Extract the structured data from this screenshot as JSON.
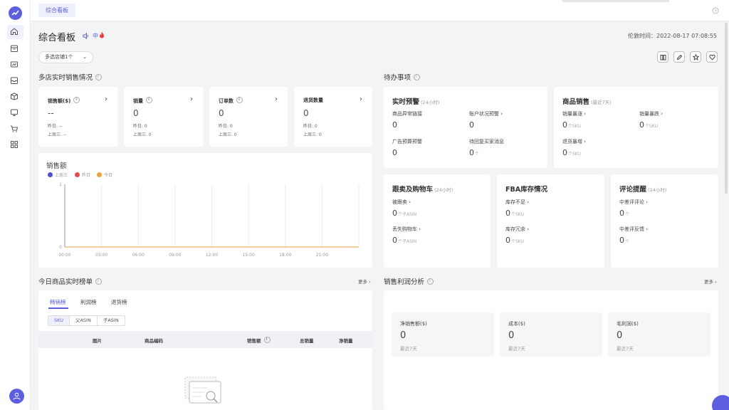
{
  "colors": {
    "accent": "#5b5fe0",
    "last_week": "#4a4fd4",
    "yesterday": "#e05050",
    "today": "#f0a040"
  },
  "topbar": {
    "tab_label": "综合看板"
  },
  "header": {
    "title": "综合看板",
    "voice_label": "中",
    "time_label": "伦敦时间：2022-08-17 07:08:55",
    "store_select": "多选店铺1个"
  },
  "sales_section": {
    "title": "多店实时销售情况",
    "kpis": [
      {
        "title": "销售额($)",
        "value": "--",
        "yesterday": "昨日: --",
        "last_week": "上周三: --"
      },
      {
        "title": "销量",
        "value": "0",
        "yesterday": "昨日: 0",
        "last_week": "上周三: 0"
      },
      {
        "title": "订单数",
        "value": "0",
        "yesterday": "昨日: 0",
        "last_week": "上周三: 0"
      },
      {
        "title": "退货数量",
        "value": "0",
        "yesterday": "昨日: 0",
        "last_week": "上周三: 0"
      }
    ]
  },
  "chart_data": {
    "type": "line",
    "title": "销售额",
    "x": [
      "00:00",
      "03:00",
      "06:00",
      "09:00",
      "12:00",
      "15:00",
      "18:00",
      "21:00"
    ],
    "series": [
      {
        "name": "上周三",
        "values": [
          0,
          0,
          0,
          0,
          0,
          0,
          0,
          0
        ]
      },
      {
        "name": "昨日",
        "values": [
          0,
          0,
          0,
          0,
          0,
          0,
          0,
          0
        ]
      },
      {
        "name": "今日",
        "values": [
          0,
          0,
          0,
          0,
          0,
          0,
          0,
          0
        ]
      }
    ],
    "ylim": [
      0,
      1
    ],
    "yticks": [
      "0",
      "1"
    ],
    "grid": true,
    "legend": "top-left"
  },
  "todo_section": {
    "title": "待办事项",
    "alerts": {
      "title": "实时预警",
      "sub": "(24小时)",
      "items": [
        {
          "label": "商品异常链接",
          "value": "0"
        },
        {
          "label": "账户状况预警 ›",
          "value": "0"
        },
        {
          "label": "广告预算预警",
          "value": "0"
        },
        {
          "label": "待回复买家消息",
          "value": "0",
          "unit": "个"
        }
      ]
    },
    "product_sales": {
      "title": "商品销售",
      "sub": "(最近7天)",
      "items": [
        {
          "label": "销量暴涨 ›",
          "value": "0",
          "unit": "个SKU"
        },
        {
          "label": "销量暴跌 ›",
          "value": "0",
          "unit": "个SKU"
        },
        {
          "label": "退货暴增 ›",
          "value": "0",
          "unit": "个SKU"
        }
      ]
    },
    "buybox": {
      "title": "跟卖及购物车",
      "sub": "(24小时)",
      "items": [
        {
          "label": "被跟卖 ›",
          "value": "0",
          "unit": "个子ASIN"
        },
        {
          "label": "丢失购物车 ›",
          "value": "0",
          "unit": "个子ASIN"
        }
      ]
    },
    "fba": {
      "title": "FBA库存情况",
      "items": [
        {
          "label": "库存不足 ›",
          "value": "0",
          "unit": "个SKU"
        },
        {
          "label": "库存冗余 ›",
          "value": "0",
          "unit": "个SKU"
        }
      ]
    },
    "reviews": {
      "title": "评论提醒",
      "sub": "(24小时)",
      "items": [
        {
          "label": "中差评评论 ›",
          "value": "0",
          "unit": "个"
        },
        {
          "label": "中差评反馈 ›",
          "value": "0",
          "unit": "个"
        }
      ]
    }
  },
  "ranking_section": {
    "title": "今日商品实时榜单",
    "more": "更多 ›",
    "tabs": [
      "畅销榜",
      "利润榜",
      "退货榜"
    ],
    "segments": [
      "SKU",
      "父ASIN",
      "子ASIN"
    ],
    "columns": [
      "图片",
      "商品编码",
      "销售额",
      "总销量",
      "净销量"
    ]
  },
  "profit_section": {
    "title": "销售利润分析",
    "more": "更多 ›",
    "boxes": [
      {
        "label": "净销售额($)",
        "value": "0",
        "sub": "最近7天"
      },
      {
        "label": "成本($)",
        "value": "0",
        "sub": "最近7天"
      },
      {
        "label": "毛利润($)",
        "value": "0",
        "sub": "最近7天"
      }
    ]
  }
}
